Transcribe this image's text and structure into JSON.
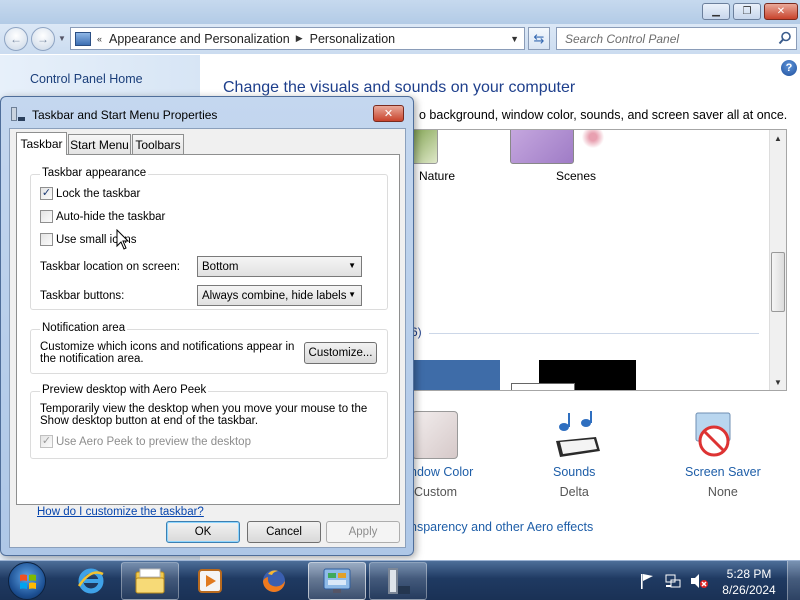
{
  "control_panel": {
    "breadcrumb": [
      "Appearance and Personalization",
      "Personalization"
    ],
    "search_placeholder": "Search Control Panel",
    "sidebar": {
      "home_link": "Control Panel Home"
    },
    "heading": "Change the visuals and sounds on your computer",
    "subheading": "o background, window color, sounds, and screen saver all at once.",
    "themes": {
      "nature_label": "Nature",
      "scenes_label": "Scenes",
      "basic_count": "6)"
    },
    "items": {
      "window_color": {
        "label": "ndow Color",
        "value": "Custom"
      },
      "sounds": {
        "label": "Sounds",
        "value": "Delta"
      },
      "screen_saver": {
        "label": "Screen Saver",
        "value": "None"
      }
    },
    "aero_link": "nsparency and other Aero effects"
  },
  "dialog": {
    "title": "Taskbar and Start Menu Properties",
    "tabs": [
      "Taskbar",
      "Start Menu",
      "Toolbars"
    ],
    "appearance": {
      "title": "Taskbar appearance",
      "lock_label": "Lock the taskbar",
      "lock_checked": true,
      "autohide_label": "Auto-hide the taskbar",
      "autohide_checked": false,
      "small_icons_label": "Use small icons",
      "small_icons_checked": false,
      "location_label": "Taskbar location on screen:",
      "location_value": "Bottom",
      "buttons_label": "Taskbar buttons:",
      "buttons_value": "Always combine, hide labels"
    },
    "notification": {
      "title": "Notification area",
      "text": "Customize which icons and notifications appear in the notification area.",
      "button": "Customize..."
    },
    "peek": {
      "title": "Preview desktop with Aero Peek",
      "text": "Temporarily view the desktop when you move your mouse to the Show desktop button at end of the taskbar.",
      "checkbox_label": "Use Aero Peek to preview the desktop",
      "checkbox_checked": true,
      "checkbox_enabled": false
    },
    "help_link": "How do I customize the taskbar?",
    "buttons": {
      "ok": "OK",
      "cancel": "Cancel",
      "apply": "Apply"
    }
  },
  "taskbar": {
    "clock_time": "5:28 PM",
    "clock_date": "8/26/2024",
    "pinned": [
      "internet-explorer-icon",
      "windows-explorer-icon",
      "media-player-icon",
      "firefox-icon",
      "control-panel-icon",
      "taskbar-properties-icon"
    ]
  },
  "colors": {
    "link_blue": "#1e5ea8",
    "heading_blue": "#1e3f8c",
    "dialog_frame": "#aec7e7",
    "taskbar": "#1f3a62"
  }
}
